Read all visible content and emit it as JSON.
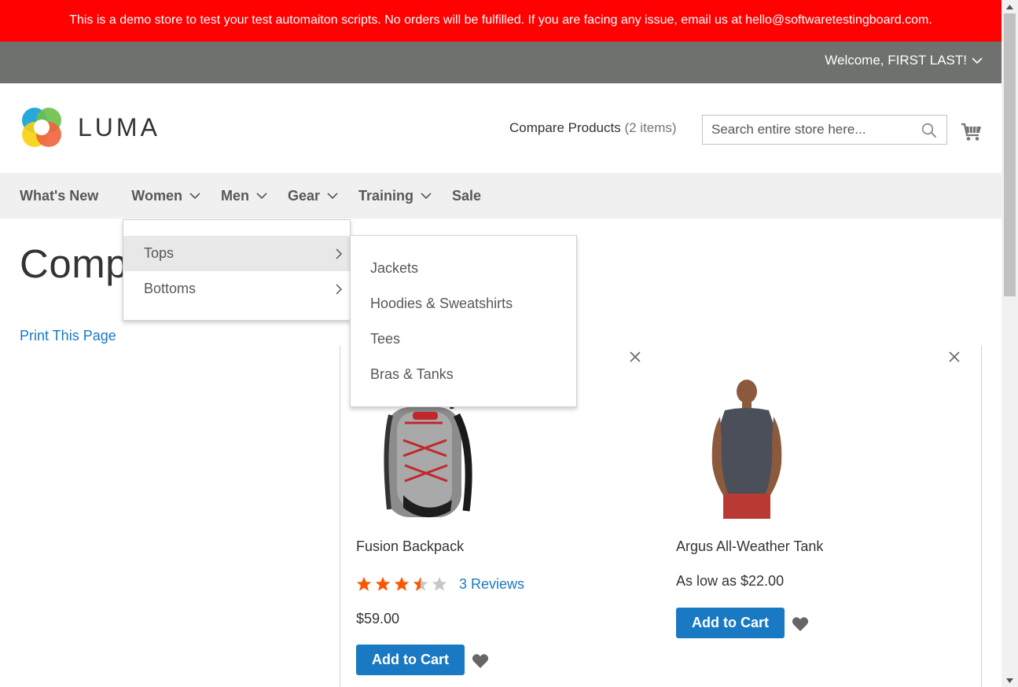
{
  "banner": {
    "text": "This is a demo store to test your test automaiton scripts. No orders will be fulfilled. If you are facing any issue, email us at hello@softwaretestingboard.com."
  },
  "header": {
    "welcome": "Welcome, FIRST LAST!",
    "logo_text": "LUMA",
    "compare_label": "Compare Products",
    "compare_count": "(2 items)",
    "search_placeholder": "Search entire store here...",
    "colors": {
      "banner": "#ff0101",
      "panel": "#6e716e",
      "accent": "#1979c3"
    }
  },
  "nav": {
    "items": [
      {
        "label": "What's New",
        "has_dropdown": false
      },
      {
        "label": "Women",
        "has_dropdown": true
      },
      {
        "label": "Men",
        "has_dropdown": true
      },
      {
        "label": "Gear",
        "has_dropdown": true
      },
      {
        "label": "Training",
        "has_dropdown": true
      },
      {
        "label": "Sale",
        "has_dropdown": false
      }
    ]
  },
  "women_menu": {
    "items": [
      {
        "label": "Tops",
        "active": true
      },
      {
        "label": "Bottoms",
        "active": false
      }
    ]
  },
  "tops_menu": {
    "items": [
      {
        "label": "Jackets"
      },
      {
        "label": "Hoodies & Sweatshirts"
      },
      {
        "label": "Tees"
      },
      {
        "label": "Bras & Tanks"
      }
    ]
  },
  "main": {
    "page_title": "Compare Products",
    "print_link": "Print This Page"
  },
  "products": [
    {
      "name": "Fusion Backpack",
      "rating": 3.5,
      "rating_max": 5,
      "reviews": "3 Reviews",
      "price": "$59.00",
      "add_to_cart": "Add to Cart"
    },
    {
      "name": "Argus All-Weather Tank",
      "price": "As low as $22.00",
      "add_to_cart": "Add to Cart"
    }
  ]
}
